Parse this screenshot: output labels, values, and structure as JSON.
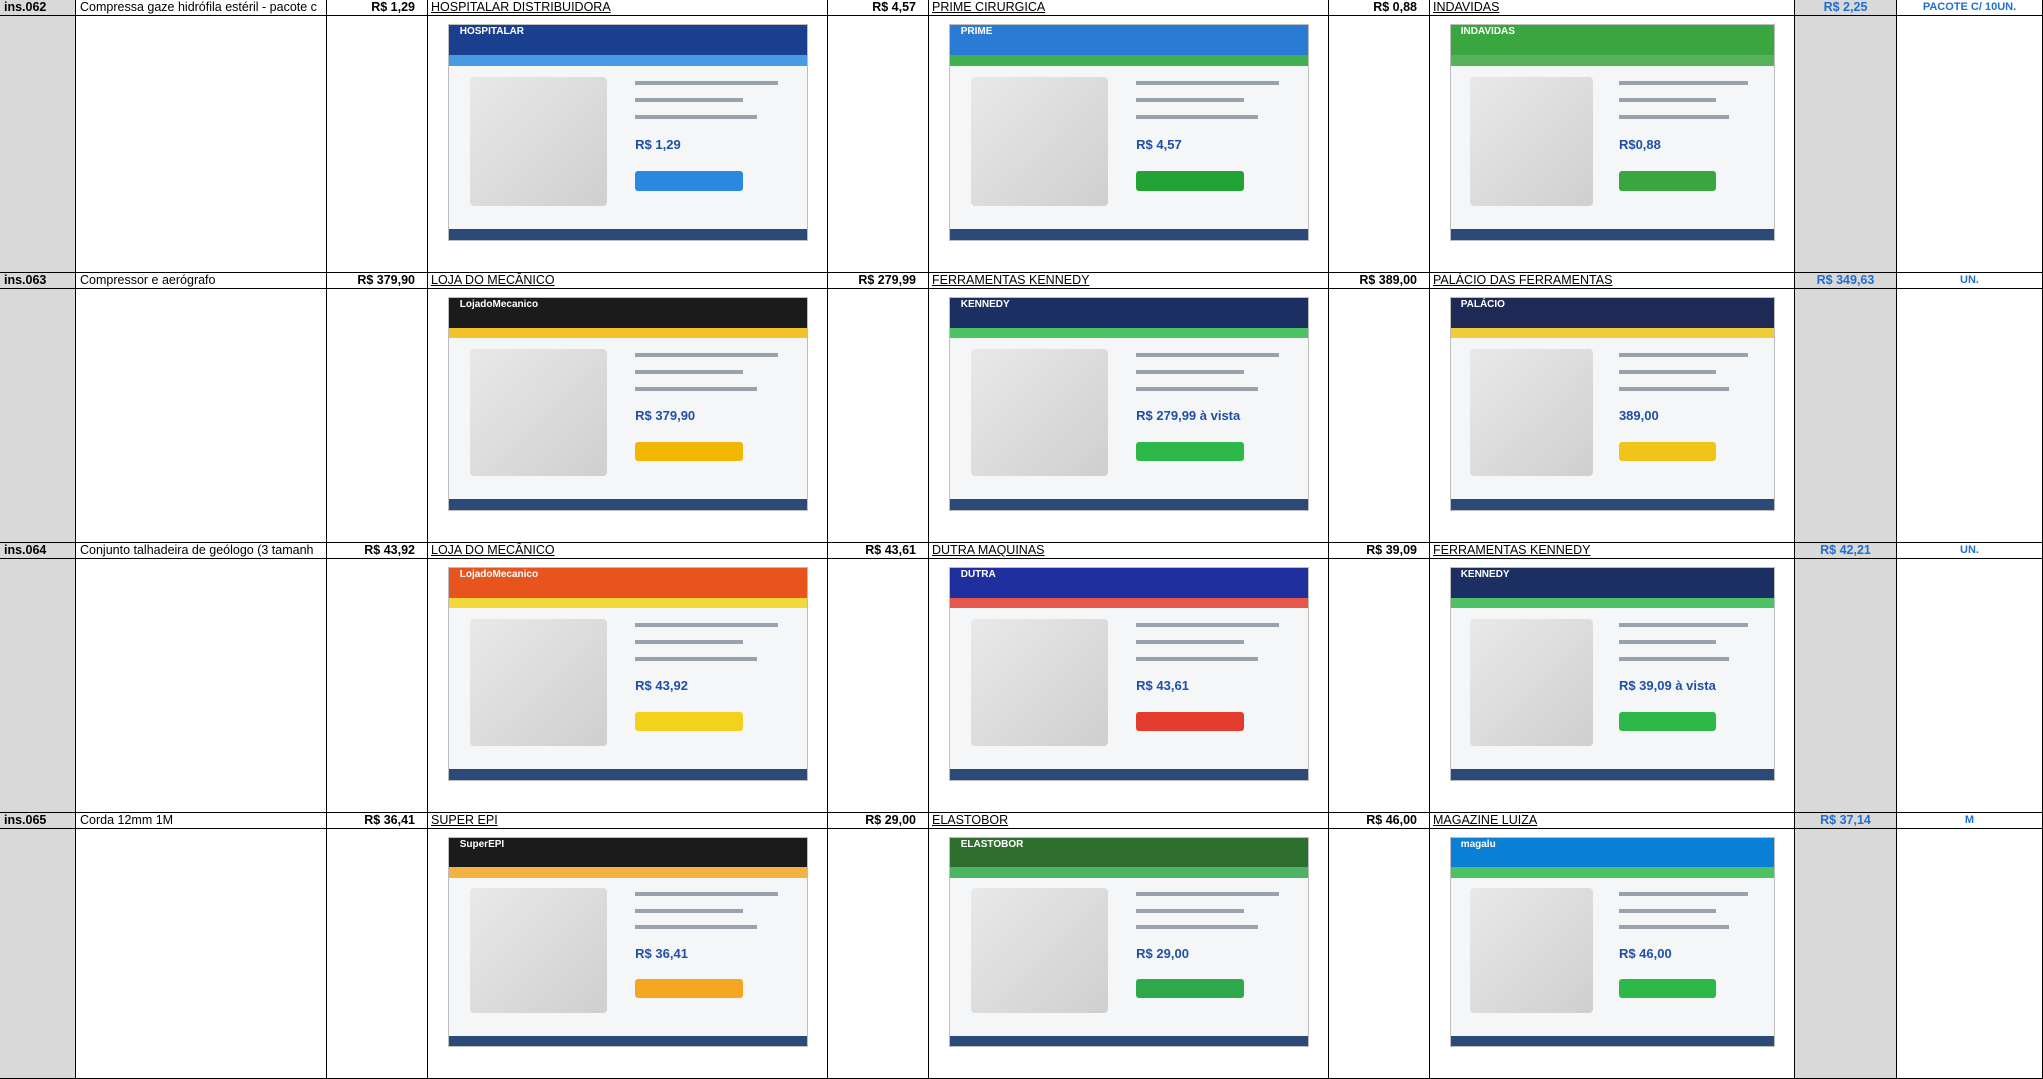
{
  "rows": [
    {
      "code": "ins.062",
      "description": "Compressa gaze hidrófila estéril - pacote c",
      "price_ref": "R$ 1,29",
      "quotes": [
        {
          "store": "HOSPITALAR DISTRIBUIDORA",
          "price": "R$ 4,57",
          "shot_price": "R$ 1,29",
          "theme": "#1b3f8f",
          "accent": "#2a8ae0",
          "logo": "HOSPITALAR"
        },
        {
          "store": "PRIME CIRURGICA",
          "price": "R$ 0,88",
          "shot_price": "R$ 4,57",
          "theme": "#2a7bd4",
          "accent": "#21a336",
          "logo": "PRIME"
        },
        {
          "store": "INDAVIDAS",
          "price": "",
          "shot_price": "R$0,88",
          "theme": "#3aa63f",
          "accent": "#3aa63f",
          "logo": "INDAVIDAS"
        }
      ],
      "average": "R$ 2,25",
      "unit": "PACOTE C/ 10UN."
    },
    {
      "code": "ins.063",
      "description": "Compressor e aerógrafo",
      "price_ref": "R$ 379,90",
      "quotes": [
        {
          "store": "LOJA DO MECÂNICO",
          "price": "R$ 279,99",
          "shot_price": "R$ 379,90",
          "theme": "#1b1b1b",
          "accent": "#f2b705",
          "logo": "LojadoMecanico"
        },
        {
          "store": "FERRAMENTAS KENNEDY",
          "price": "R$ 389,00",
          "shot_price": "R$ 279,99 à vista",
          "theme": "#1c2f63",
          "accent": "#2eb84a",
          "logo": "KENNEDY"
        },
        {
          "store": "PALÁCIO DAS FERRAMENTAS",
          "price": "",
          "shot_price": "389,00",
          "theme": "#1e2a55",
          "accent": "#f0c419",
          "logo": "PALÁCIO"
        }
      ],
      "average": "R$ 349,63",
      "unit": "UN."
    },
    {
      "code": "ins.064",
      "description": "Conjunto talhadeira de geólogo (3 tamanh",
      "price_ref": "R$ 43,92",
      "quotes": [
        {
          "store": "LOJA DO MECÂNICO",
          "price": "R$ 43,61",
          "shot_price": "R$ 43,92",
          "theme": "#e8541d",
          "accent": "#f2d21b",
          "logo": "LojadoMecanico"
        },
        {
          "store": "DUTRA MAQUINAS",
          "price": "R$ 39,09",
          "shot_price": "R$ 43,61",
          "theme": "#1f2f9e",
          "accent": "#e33b2e",
          "logo": "DUTRA"
        },
        {
          "store": "FERRAMENTAS KENNEDY",
          "price": "",
          "shot_price": "R$ 39,09 à vista",
          "theme": "#1c2f63",
          "accent": "#2eb84a",
          "logo": "KENNEDY"
        }
      ],
      "average": "R$ 42,21",
      "unit": "UN."
    },
    {
      "code": "ins.065",
      "description": "Corda 12mm 1M",
      "price_ref": "R$ 36,41",
      "quotes": [
        {
          "store": "SUPER EPI",
          "price": "R$ 29,00",
          "shot_price": "R$ 36,41",
          "theme": "#1b1b1b",
          "accent": "#f5a623",
          "logo": "SuperEPI"
        },
        {
          "store": "ELASTOBOR",
          "price": "R$ 46,00",
          "shot_price": "R$ 29,00",
          "theme": "#2e6e2e",
          "accent": "#2ea84a",
          "logo": "ELASTOBOR"
        },
        {
          "store": "MAGAZINE LUIZA",
          "price": "",
          "shot_price": "R$ 46,00",
          "theme": "#0a7fd6",
          "accent": "#2eb84a",
          "logo": "magalu"
        }
      ],
      "average": "R$ 37,14",
      "unit": "M"
    }
  ]
}
